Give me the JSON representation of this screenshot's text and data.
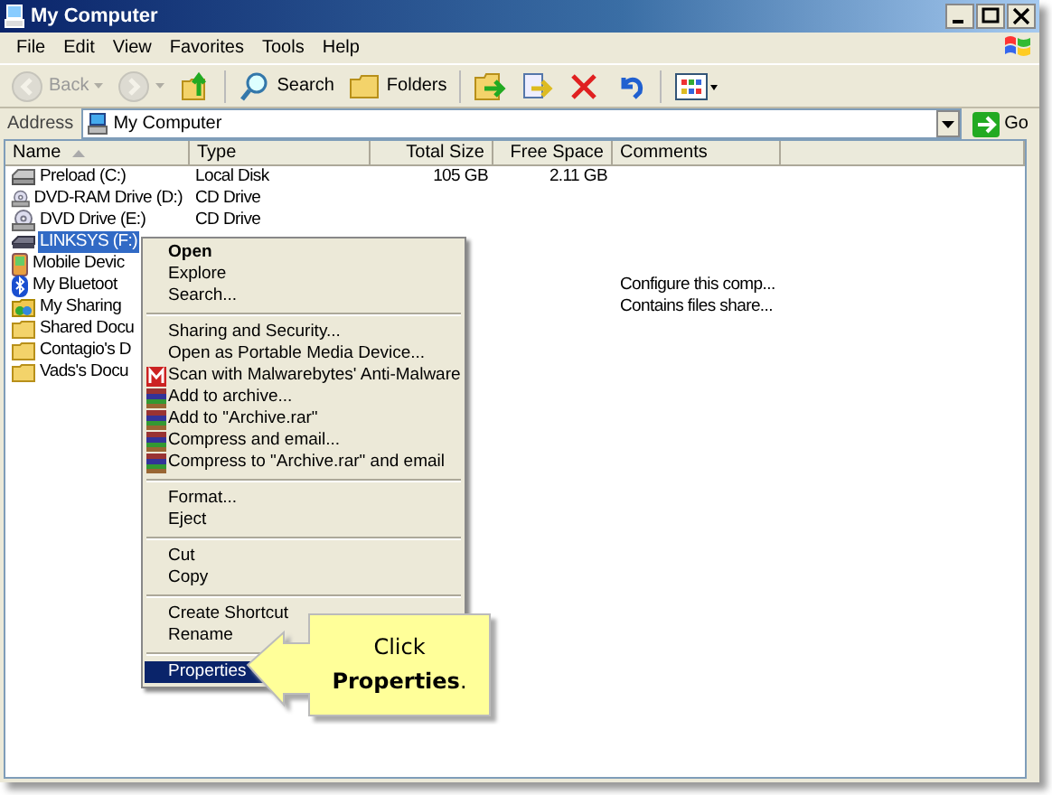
{
  "window": {
    "title": "My Computer"
  },
  "menu_bar": [
    "File",
    "Edit",
    "View",
    "Favorites",
    "Tools",
    "Help"
  ],
  "toolbar": [
    {
      "kind": "back",
      "label": "Back",
      "disabled": true
    },
    {
      "kind": "forward",
      "disabled": true
    },
    {
      "kind": "up",
      "disabled": false
    },
    {
      "kind": "search",
      "label": "Search",
      "disabled": false
    },
    {
      "kind": "folders",
      "label": "Folders",
      "disabled": false
    },
    {
      "kind": "move",
      "disabled": false
    },
    {
      "kind": "copy",
      "disabled": false
    },
    {
      "kind": "delete",
      "disabled": false
    },
    {
      "kind": "undo",
      "disabled": false
    },
    {
      "kind": "views",
      "disabled": false
    }
  ],
  "address": {
    "label": "Address",
    "value": "My Computer",
    "go": "Go"
  },
  "columns": [
    "Name",
    "Type",
    "Total Size",
    "Free Space",
    "Comments"
  ],
  "files": [
    {
      "kind": "disk",
      "name": "Preload (C:)",
      "type": "Local Disk",
      "total_size": "105 GB",
      "free_space": "2.11 GB",
      "selected": false
    },
    {
      "kind": "cd",
      "name": "DVD-RAM Drive (D:)",
      "type": "CD Drive",
      "selected": false
    },
    {
      "kind": "cd",
      "name": "DVD Drive (E:)",
      "type": "CD Drive",
      "selected": false
    },
    {
      "kind": "removable",
      "name": "LINKSYS (F:)",
      "selected": true
    },
    {
      "kind": "phone",
      "name": "Mobile Devic",
      "selected": false
    },
    {
      "kind": "bluetooth",
      "name": "My Bluetoot",
      "comments": "Configure this comp...",
      "selected": false
    },
    {
      "kind": "sharing",
      "name": "My Sharing",
      "comments": "Contains files share...",
      "selected": false
    },
    {
      "kind": "folder",
      "name": "Shared Docu",
      "selected": false
    },
    {
      "kind": "folder",
      "name": "Contagio's D",
      "selected": false
    },
    {
      "kind": "folder",
      "name": "Vads's Docu",
      "selected": false
    }
  ],
  "context_menu": {
    "groups": [
      [
        {
          "label": "Open",
          "default": true,
          "selected": false
        },
        {
          "label": "Explore",
          "default": false,
          "selected": false
        },
        {
          "label": "Search...",
          "default": false,
          "selected": false
        }
      ],
      [
        {
          "label": "Sharing and Security...",
          "default": false,
          "selected": false
        },
        {
          "label": "Open as Portable Media Device...",
          "default": false,
          "selected": false
        },
        {
          "label": "Scan with Malwarebytes' Anti-Malware",
          "kind": "malware",
          "default": false,
          "selected": false
        },
        {
          "label": "Add to archive...",
          "kind": "archive",
          "default": false,
          "selected": false
        },
        {
          "label": "Add to \"Archive.rar\"",
          "kind": "archive",
          "default": false,
          "selected": false
        },
        {
          "label": "Compress and email...",
          "kind": "archive",
          "default": false,
          "selected": false
        },
        {
          "label": "Compress to \"Archive.rar\" and email",
          "kind": "archive",
          "default": false,
          "selected": false
        }
      ],
      [
        {
          "label": "Format...",
          "default": false,
          "selected": false
        },
        {
          "label": "Eject",
          "default": false,
          "selected": false
        }
      ],
      [
        {
          "label": "Cut",
          "default": false,
          "selected": false
        },
        {
          "label": "Copy",
          "default": false,
          "selected": false
        }
      ],
      [
        {
          "label": "Create Shortcut",
          "default": false,
          "selected": false
        },
        {
          "label": "Rename",
          "default": false,
          "selected": false
        }
      ],
      [
        {
          "label": "Properties",
          "default": false,
          "selected": true
        }
      ]
    ]
  },
  "callout": {
    "text": "Click **Properties**."
  }
}
